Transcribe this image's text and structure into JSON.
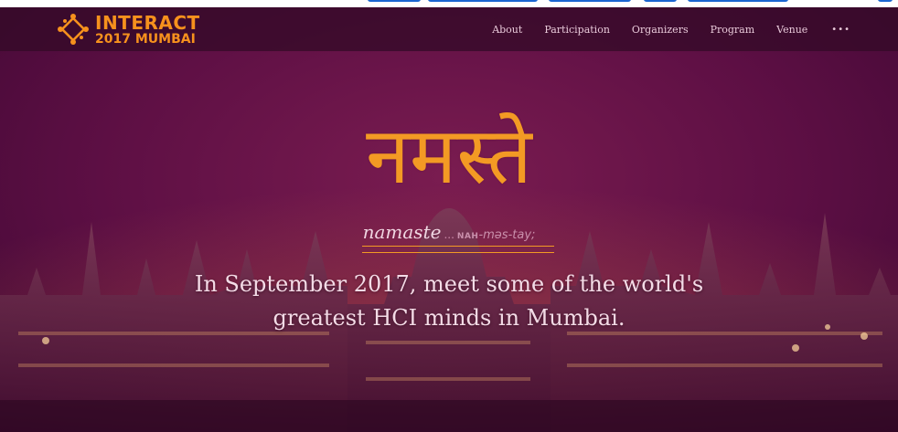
{
  "navbar": {
    "logo": {
      "title": "INTERACT",
      "subtitle": "2017 MUMBAI"
    },
    "links": [
      "About",
      "Participation",
      "Organizers",
      "Program",
      "Venue"
    ],
    "more_label": "•••"
  },
  "hero": {
    "headline_hindi": "नमस्ते",
    "pronunciation_word": "namaste",
    "pronunciation_separator": "...",
    "pronunciation_stress": "NAH",
    "pronunciation_rest": "-məs-tay;",
    "tagline_line1": "In September 2017, meet some of the world's",
    "tagline_line2": "greatest HCI minds in Mumbai."
  },
  "colors": {
    "accent": "#f39a24",
    "hero_overlay": "#5d0f44",
    "navbar": "#340a28",
    "top_link_fragment": "#1b66d1"
  }
}
